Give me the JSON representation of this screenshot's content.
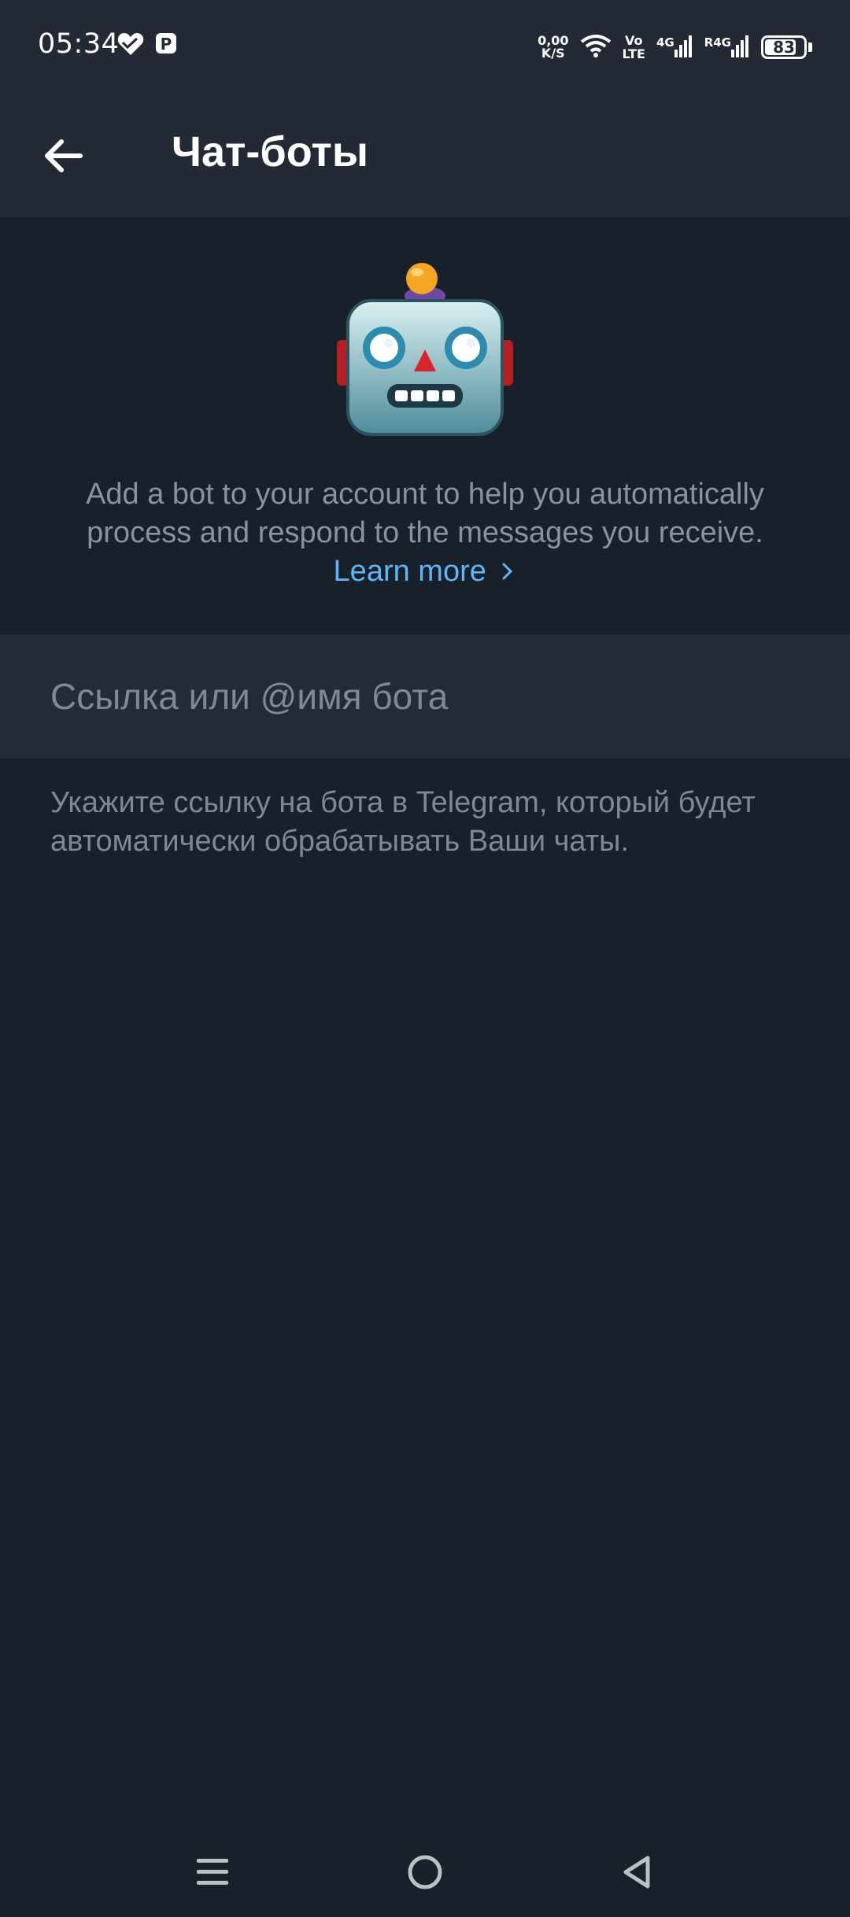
{
  "status_bar": {
    "time": "05:34",
    "speed_value": "0,00",
    "speed_unit": "K/S",
    "volte_top": "Vo",
    "volte_bottom": "LTE",
    "network1": "4G",
    "network2": "R4G",
    "battery": "83",
    "battery_level_pct": 83,
    "icons": [
      "heart-icon",
      "p-app-icon",
      "wifi-icon",
      "signal-icon",
      "signal-icon",
      "battery-icon"
    ]
  },
  "app_bar": {
    "back_icon": "back-arrow-icon",
    "title": "Чат-боты"
  },
  "hero": {
    "image_icon": "robot-emoji-icon",
    "description": "Add a bot to your account to help you automatically process and respond to the messages you receive.",
    "learn_more": "Learn more",
    "learn_more_icon": "chevron-right-icon"
  },
  "bot_input": {
    "placeholder": "Ссылка или @имя бота",
    "value": ""
  },
  "hint": "Укажите ссылку на бота в Telegram, который будет автоматически обрабатывать Ваши чаты.",
  "nav_bar": {
    "icons": [
      "menu-icon",
      "home-icon",
      "back-icon"
    ]
  },
  "colors": {
    "background": "#18202a",
    "header": "#242a35",
    "input_row": "#232b36",
    "accent_link": "#5eb5f7",
    "secondary_text": "#7f8893"
  }
}
